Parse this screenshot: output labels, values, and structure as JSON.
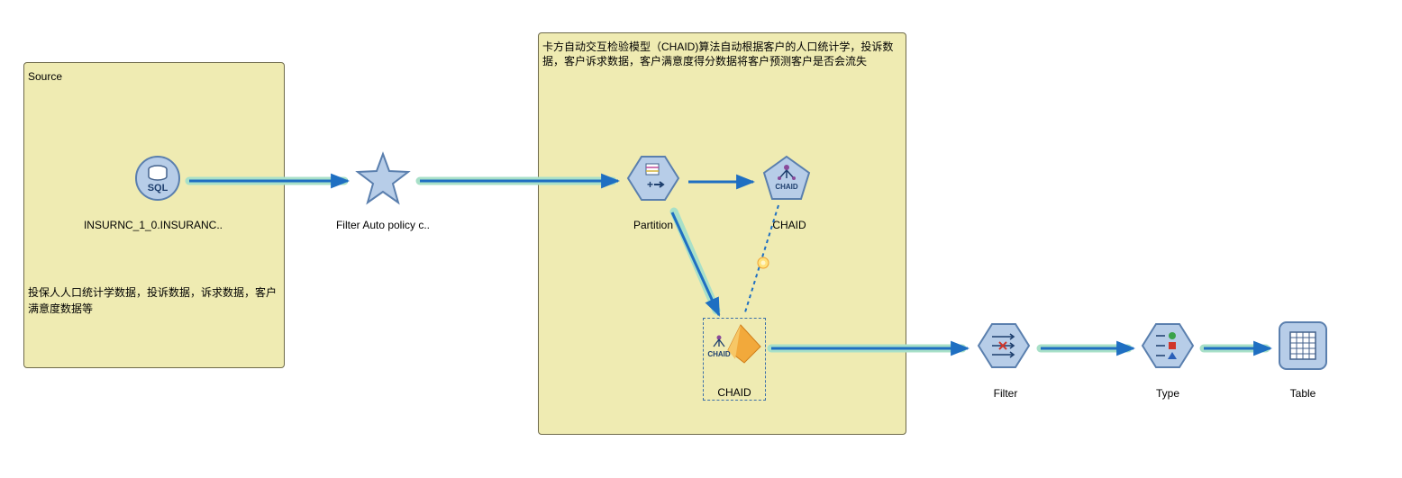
{
  "comments": {
    "source": {
      "title": "Source",
      "note": "投保人人口统计学数据，投诉数据，诉求数据，客户满意度数据等"
    },
    "model": {
      "text": "卡方自动交互检验模型（CHAID)算法自动根据客户的人口统计学，投诉数据，客户诉求数据，客户满意度得分数据将客户预测客户是否会流失"
    }
  },
  "nodes": {
    "sql": {
      "label": "INSURNC_1_0.INSURANC..",
      "icon": "database-sql-icon",
      "badge": "SQL"
    },
    "select": {
      "label": "Filter Auto policy c..",
      "icon": "star-select-icon"
    },
    "partition": {
      "label": "Partition",
      "icon": "partition-icon"
    },
    "chaid_build": {
      "label": "CHAID",
      "icon": "chaid-modeling-icon",
      "badge": "CHAID"
    },
    "chaid_model": {
      "label": "CHAID",
      "icon": "chaid-nugget-icon",
      "badge": "CHAID"
    },
    "filter": {
      "label": "Filter",
      "icon": "filter-icon"
    },
    "type": {
      "label": "Type",
      "icon": "type-icon"
    },
    "table": {
      "label": "Table",
      "icon": "table-icon"
    }
  },
  "colors": {
    "node_fill": "#b7cde8",
    "node_stroke": "#5a7fae",
    "link": "#1f6fc2",
    "link_glow": "#a8e0c8",
    "comment_bg": "#efebb2",
    "nugget": "#f2a93b"
  }
}
